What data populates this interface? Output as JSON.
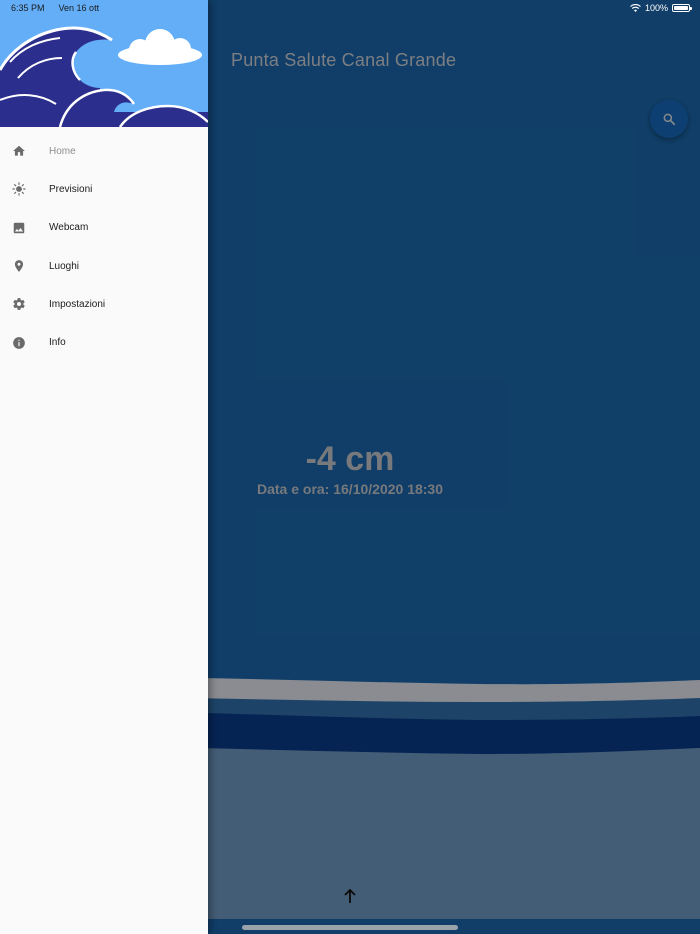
{
  "status_bar": {
    "time": "6:35 PM",
    "date": "Ven 16 ott",
    "battery": "100%"
  },
  "app": {
    "title": "Punta Salute Canal Grande",
    "level": "-4 cm",
    "timestamp": "Data e ora: 16/10/2020 18:30",
    "search_icon": "search-icon",
    "up_icon": "arrow-up-icon"
  },
  "drawer": {
    "items": [
      {
        "label": "Home",
        "icon": "home-icon",
        "active": true
      },
      {
        "label": "Previsioni",
        "icon": "sun-icon",
        "active": false
      },
      {
        "label": "Webcam",
        "icon": "image-icon",
        "active": false
      },
      {
        "label": "Luoghi",
        "icon": "location-pin-icon",
        "active": false
      },
      {
        "label": "Impostazioni",
        "icon": "gear-icon",
        "active": false
      },
      {
        "label": "Info",
        "icon": "info-icon",
        "active": false
      }
    ]
  },
  "colors": {
    "app_background": "#1a65a8",
    "drawer_background": "#fafafa",
    "header_sky": "#63aef7",
    "header_wave": "#2b2e8c"
  }
}
